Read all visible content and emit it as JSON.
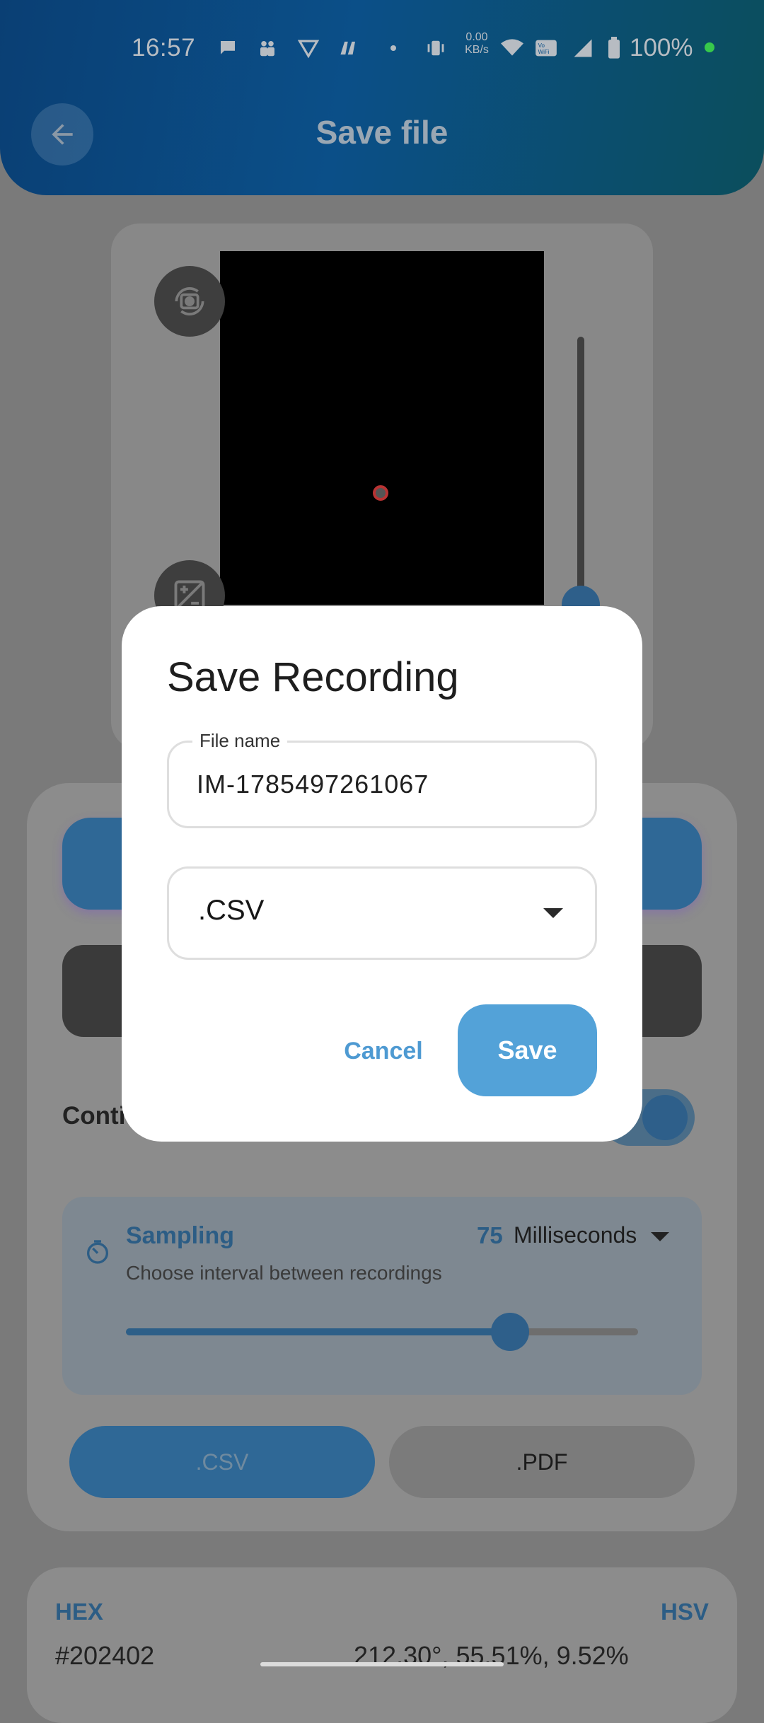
{
  "status_bar": {
    "time": "16:57",
    "net_speed_value": "0.00",
    "net_speed_unit": "KB/s",
    "battery": "100%",
    "icons": [
      "chat-icon",
      "people-icon",
      "vpn-icon",
      "app-icon",
      "dot-icon",
      "vibrate-icon",
      "wifi-icon",
      "vowifi-icon",
      "signal-icon",
      "battery-icon"
    ]
  },
  "header": {
    "title": "Save file",
    "back_icon": "arrow-left-icon"
  },
  "camera": {
    "rotate_icon": "camera-rotate-icon",
    "exposure_icon": "exposure-icon",
    "zoom_level": 0.0
  },
  "controls": {
    "continuous_label": "Conti",
    "continuous_enabled": true,
    "sampling": {
      "title": "Sampling",
      "value": "75",
      "unit": "Milliseconds",
      "description": "Choose interval between recordings",
      "slider_fraction": 0.75
    },
    "formats": [
      ".CSV",
      ".PDF"
    ],
    "selected_format": ".CSV"
  },
  "color_info": {
    "hex_label": "HEX",
    "hsv_label": "HSV",
    "hex_value": "#202402",
    "hsv_value": "212.30°, 55.51%, 9.52%"
  },
  "dialog": {
    "title": "Save Recording",
    "file_name_label": "File name",
    "file_name_value": "IM-1785497261067",
    "format_value": ".CSV",
    "cancel_label": "Cancel",
    "save_label": "Save"
  },
  "colors": {
    "accent": "#53a2d8",
    "scrim": "#7a7a7a",
    "battery_dot": "#37c84b"
  }
}
